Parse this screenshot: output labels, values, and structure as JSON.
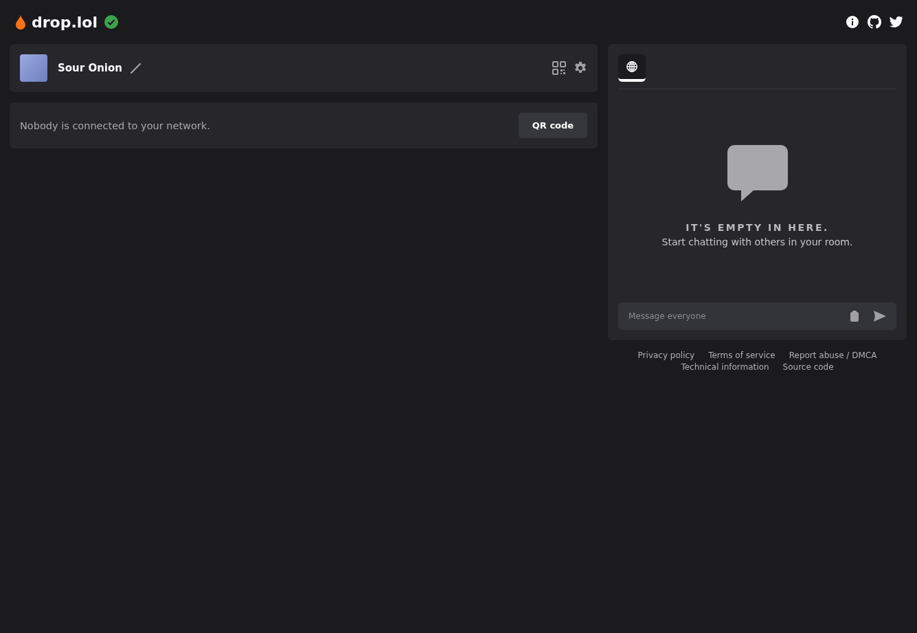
{
  "brand": {
    "name": "drop.lol",
    "verified": true
  },
  "profile": {
    "name": "Sour Onion"
  },
  "network": {
    "message": "Nobody is connected to your network.",
    "button": "QR code"
  },
  "chat": {
    "tabs": [
      {
        "selected": true
      }
    ],
    "empty_title": "IT'S EMPTY IN HERE.",
    "empty_text": "Start chatting with others in your room.",
    "input": {
      "placeholder": "Message everyone"
    }
  },
  "footer_links": [
    "Privacy policy",
    "Terms of service",
    "Report abuse / DMCA",
    "Technical information",
    "Source code"
  ]
}
